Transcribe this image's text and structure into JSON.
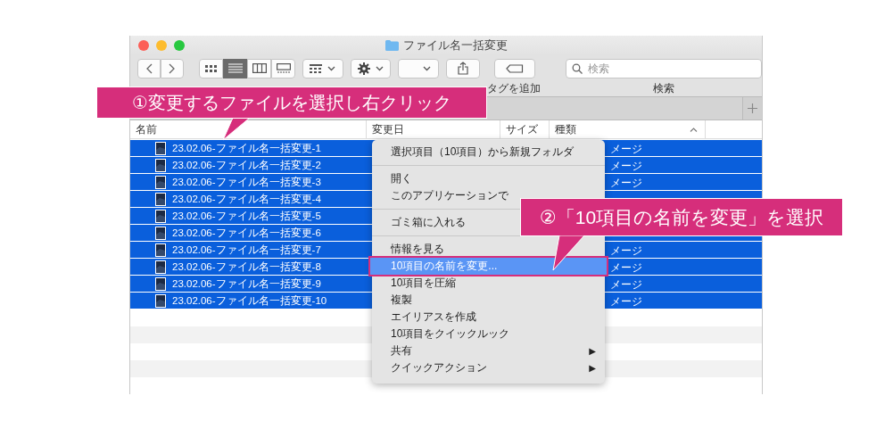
{
  "window": {
    "title": "ファイル名一括変更"
  },
  "toolbar": {
    "view_modes": [
      {
        "selected": false
      },
      {
        "selected": true
      },
      {
        "selected": false
      },
      {
        "selected": false
      }
    ],
    "labels": [
      "タグを追加",
      "検索"
    ],
    "search": {
      "placeholder": "検索"
    }
  },
  "columns": [
    "名前",
    "変更日",
    "サイズ",
    "種類"
  ],
  "rows": [
    {
      "name": "23.02.06-ファイル名一括変更-1",
      "kind": "メージ",
      "selected": true
    },
    {
      "name": "23.02.06-ファイル名一括変更-2",
      "kind": "メージ",
      "selected": true
    },
    {
      "name": "23.02.06-ファイル名一括変更-3",
      "kind": "メージ",
      "selected": true
    },
    {
      "name": "23.02.06-ファイル名一括変更-4",
      "selected": true
    },
    {
      "name": "23.02.06-ファイル名一括変更-5",
      "selected": true
    },
    {
      "name": "23.02.06-ファイル名一括変更-6",
      "selected": true
    },
    {
      "name": "23.02.06-ファイル名一括変更-7",
      "kind": "メージ",
      "selected": true
    },
    {
      "name": "23.02.06-ファイル名一括変更-8",
      "kind": "メージ",
      "selected": true
    },
    {
      "name": "23.02.06-ファイル名一括変更-9",
      "kind": "メージ",
      "selected": true
    },
    {
      "name": "23.02.06-ファイル名一括変更-10",
      "kind": "メージ",
      "selected": true
    }
  ],
  "context_menu": [
    {
      "kind": "item",
      "label": "選択項目（10項目）から新規フォルダ",
      "selected": false
    },
    {
      "kind": "separator"
    },
    {
      "kind": "item",
      "label": "開く",
      "selected": false
    },
    {
      "kind": "item",
      "label": "このアプリケーションで",
      "selected": false
    },
    {
      "kind": "separator"
    },
    {
      "kind": "item",
      "label": "ゴミ箱に入れる",
      "selected": false
    },
    {
      "kind": "separator"
    },
    {
      "kind": "item",
      "label": "情報を見る",
      "selected": false
    },
    {
      "kind": "item",
      "label": "10項目の名前を変更...",
      "selected": true
    },
    {
      "kind": "item",
      "label": "10項目を圧縮",
      "selected": false
    },
    {
      "kind": "item",
      "label": "複製",
      "selected": false
    },
    {
      "kind": "item",
      "label": "エイリアスを作成",
      "selected": false
    },
    {
      "kind": "item",
      "label": "10項目をクイックルック",
      "selected": false
    },
    {
      "kind": "submenu",
      "label": "共有",
      "arrow": "▶",
      "selected": false
    },
    {
      "kind": "submenu",
      "label": "クイックアクション",
      "arrow": "▶",
      "selected": false
    }
  ],
  "callouts": [
    "①変更するファイルを選択し右クリック",
    "②「10項目の名前を変更」を選択"
  ]
}
